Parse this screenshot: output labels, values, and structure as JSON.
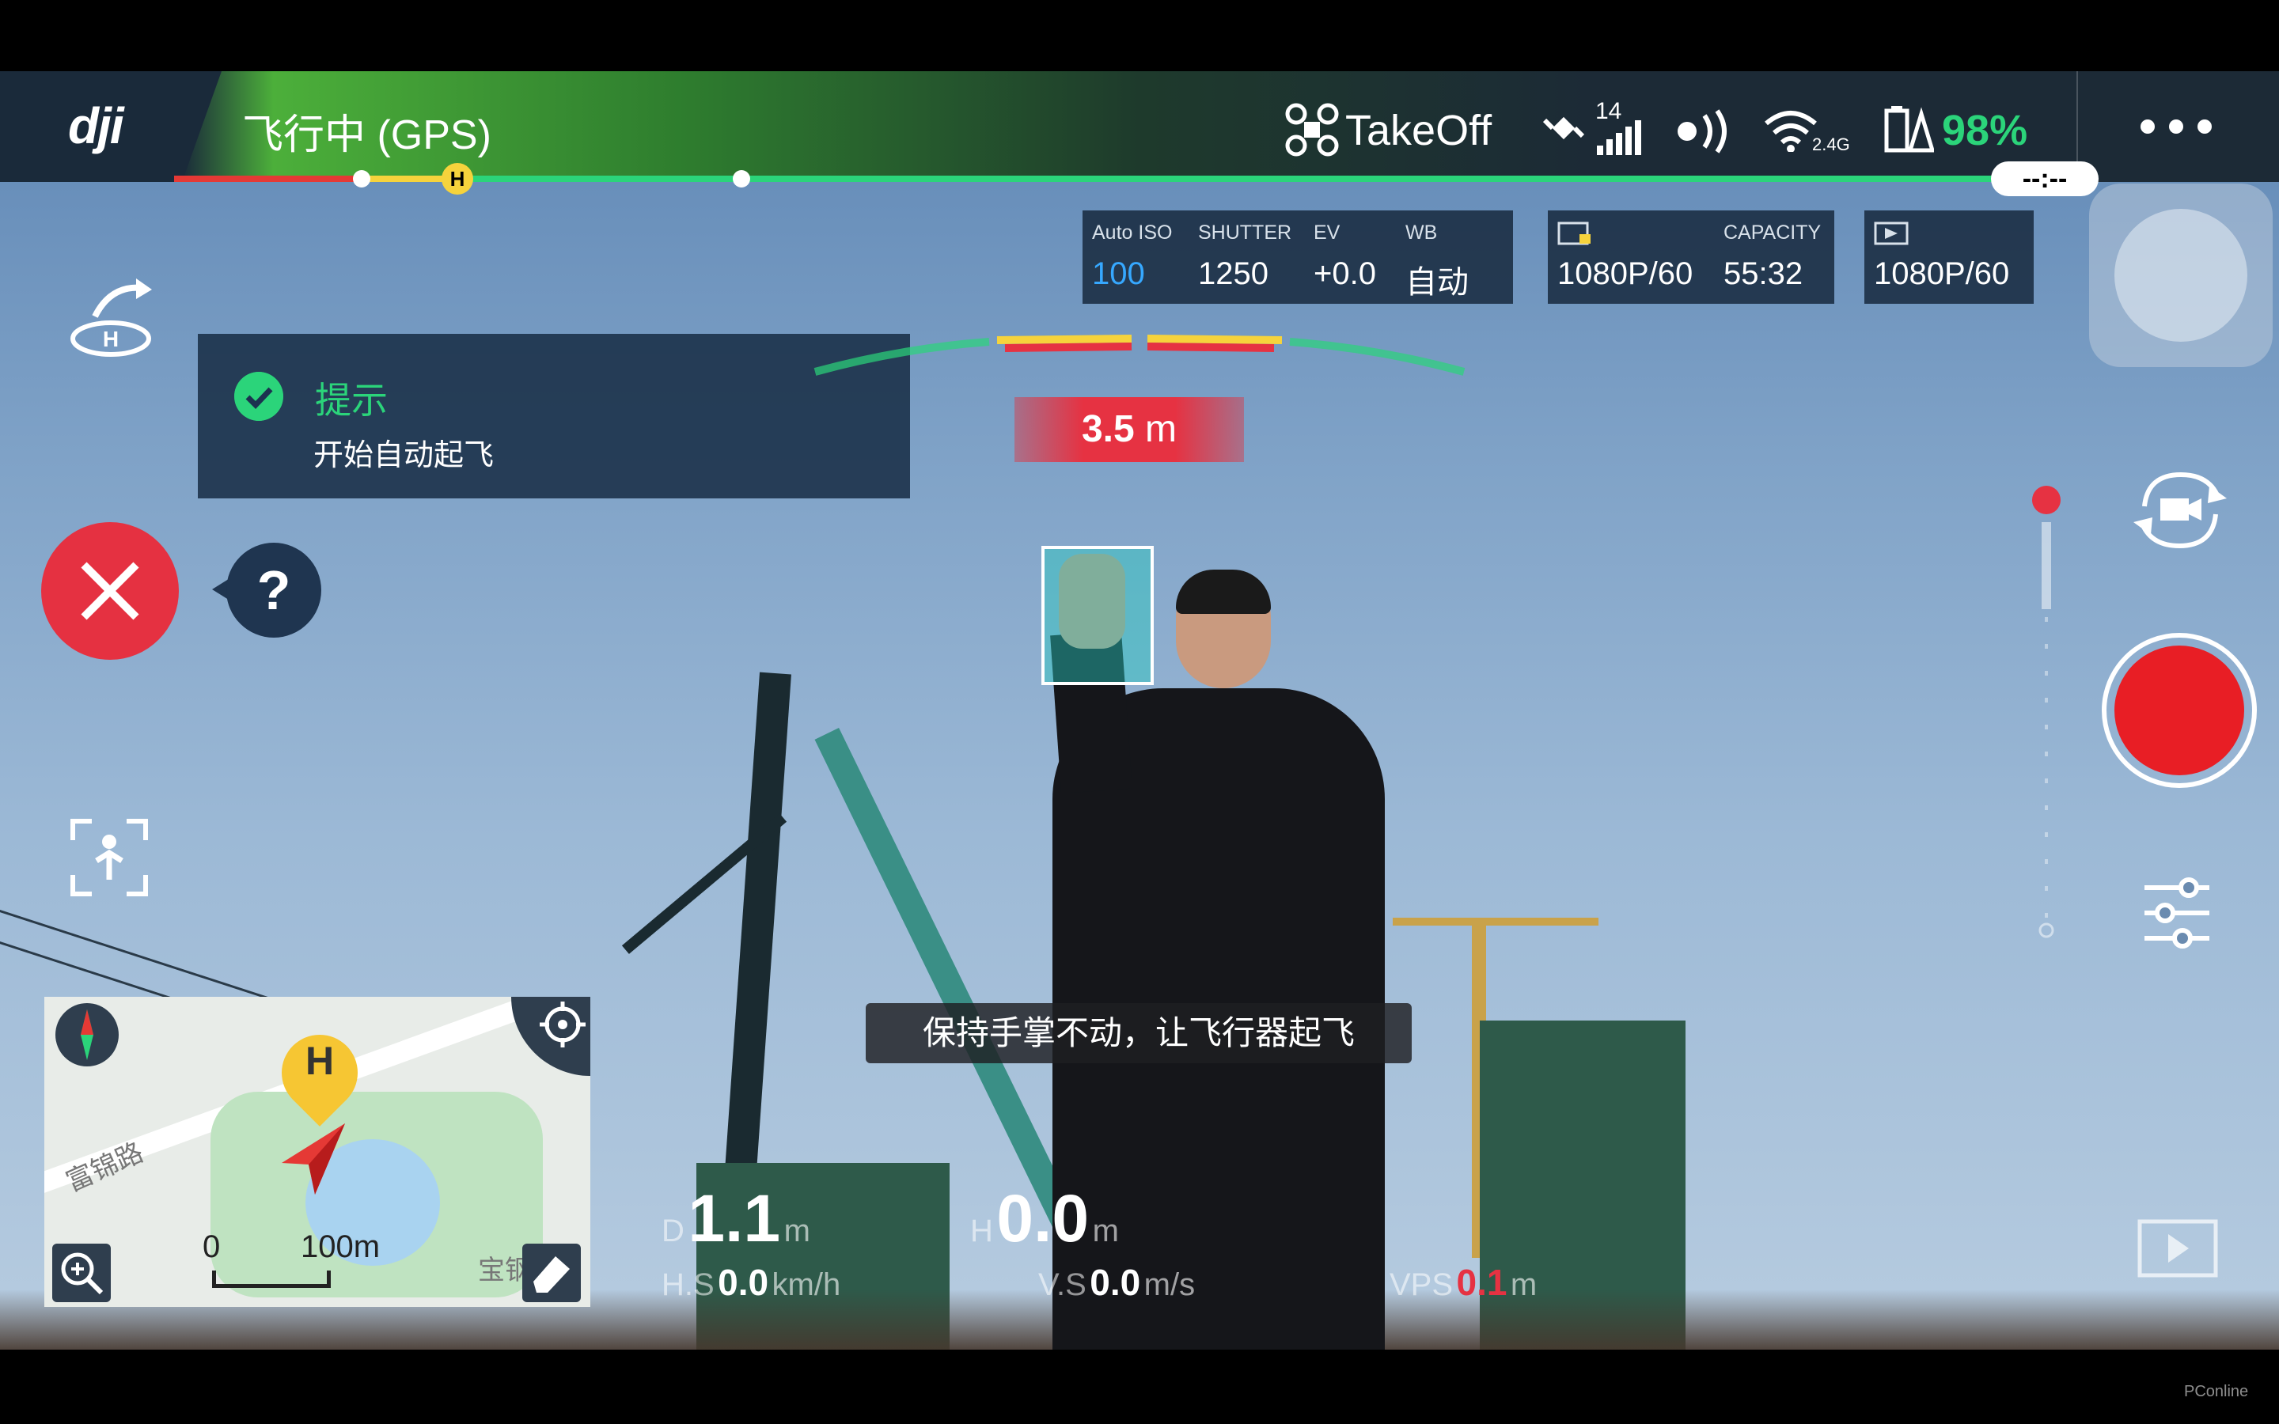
{
  "status_bar": {
    "brand": "dji",
    "flight_status": "飞行中 (GPS)",
    "mode": "TakeOff",
    "satellite_count": "14",
    "wifi_band": "2.4G",
    "battery": "98%",
    "time_remaining": "--:--",
    "colors": {
      "accent_green": "#2bd47a",
      "battery_green": "#2bd47a",
      "warn_red": "#e53935",
      "home_yellow": "#f6d33c"
    }
  },
  "camera": {
    "iso_label": "Auto ISO",
    "iso_value": "100",
    "shutter_label": "SHUTTER",
    "shutter_value": "1250",
    "ev_label": "EV",
    "ev_value": "+0.0",
    "wb_label": "WB",
    "wb_value": "自动",
    "storage_label": "CAPACITY",
    "storage_res": "1080P/60",
    "storage_capacity": "55:32",
    "transmit_res": "1080P/60"
  },
  "hint": {
    "title": "提示",
    "body": "开始自动起飞"
  },
  "altitude_warning": {
    "value": "3.5",
    "unit": "m"
  },
  "home_marker": "H",
  "help_label": "?",
  "instruction": "保持手掌不动，让飞行器起飞",
  "telemetry": {
    "d_label": "D",
    "d_value": "1.1",
    "d_unit": "m",
    "h_label": "H",
    "h_value": "0.0",
    "h_unit": "m",
    "hs_label": "H.S",
    "hs_value": "0.0",
    "hs_unit": "km/h",
    "vs_label": "V.S",
    "vs_value": "0.0",
    "vs_unit": "m/s",
    "vps_label": "VPS",
    "vps_value": "0.1",
    "vps_unit": "m"
  },
  "map": {
    "home_label": "H",
    "road_label": "富锦路",
    "road_label_2": "宝钢",
    "scale_start": "0",
    "scale_end": "100m"
  },
  "watermark": "PConline"
}
